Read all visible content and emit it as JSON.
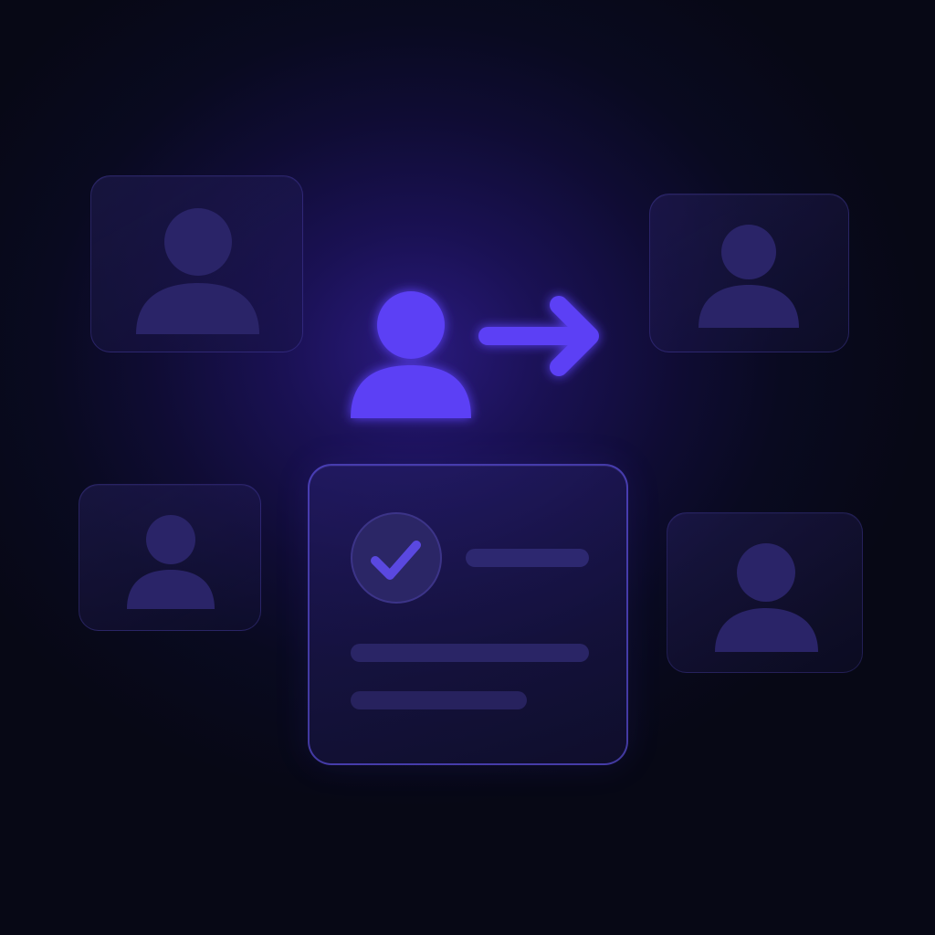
{
  "colors": {
    "background": "#080818",
    "glow": "#2a1a7e",
    "accent": "#5b3ff5",
    "card_icon": "#2a2468",
    "card_border": "#5a4ec8",
    "placeholder_bar": "#2d2870",
    "check_circle": "#2b2666",
    "check_mark": "#5a48e0"
  },
  "icons": {
    "hero_user": "user-icon",
    "hero_arrow": "arrow-right-icon",
    "check": "check-icon",
    "card_user": "user-avatar-icon"
  },
  "cards": [
    {
      "name": "profile-card-top-left"
    },
    {
      "name": "profile-card-top-right"
    },
    {
      "name": "profile-card-bottom-left"
    },
    {
      "name": "profile-card-bottom-right"
    }
  ],
  "main_card": {
    "name": "verification-card",
    "placeholder_lines": 3
  }
}
